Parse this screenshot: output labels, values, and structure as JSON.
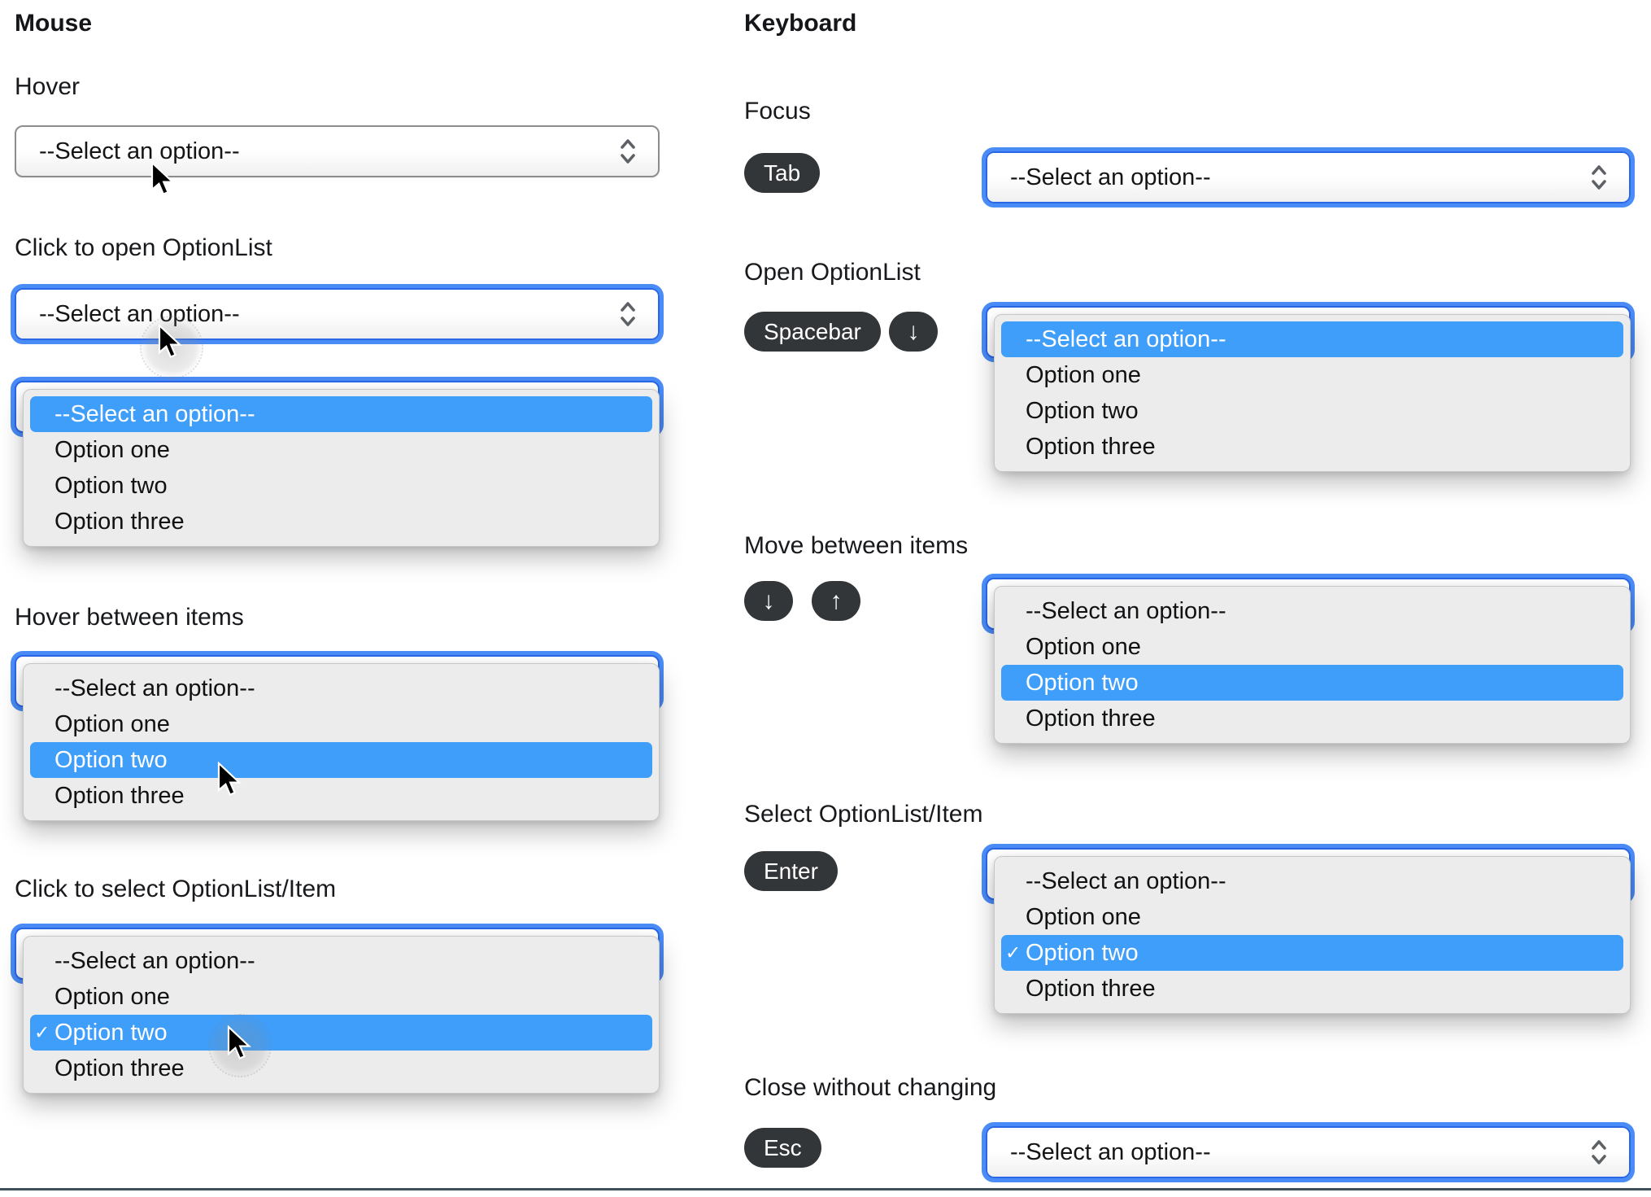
{
  "titles": {
    "mouse": "Mouse",
    "keyboard": "Keyboard"
  },
  "sections": {
    "mouse": [
      "Hover",
      "Click to open OptionList",
      "Hover between items",
      "Click to select OptionList/Item"
    ],
    "keyboard": [
      "Focus",
      "Open OptionList",
      "Move between items",
      "Select OptionList/Item",
      "Close without changing"
    ]
  },
  "select": {
    "value": "--Select an option--",
    "options": [
      "--Select an option--",
      "Option one",
      "Option two",
      "Option three"
    ]
  },
  "keys": {
    "tab": "Tab",
    "spacebar": "Spacebar",
    "down_arrow": "↓",
    "up_arrow": "↑",
    "enter": "Enter",
    "esc": "Esc"
  },
  "checkmark": "✓",
  "colors": {
    "highlight": "#3F9EFA",
    "focus_ring": "#4A8CF7",
    "panel": "#ECECEC",
    "keycap": "#333639",
    "divider": "#40505B"
  }
}
